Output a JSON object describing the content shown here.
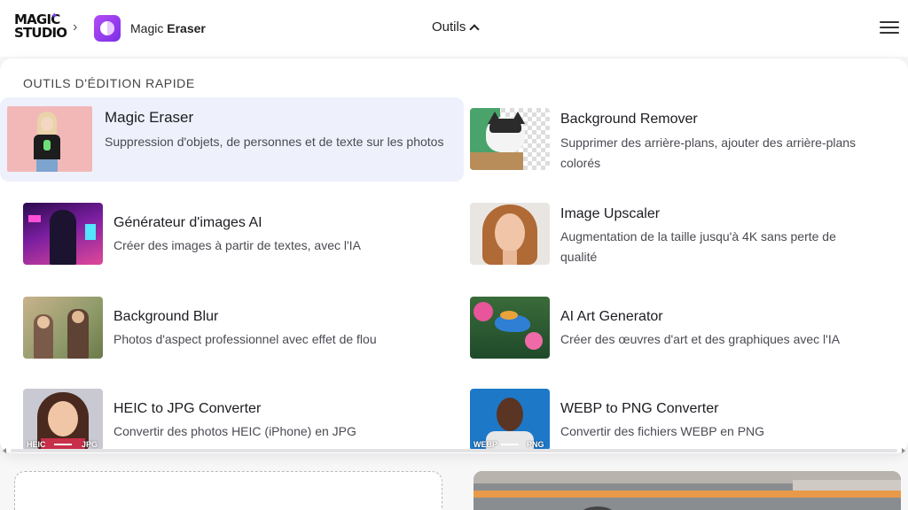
{
  "header": {
    "logo_line1": "MAGIC",
    "logo_line2": "STUDIO",
    "breadcrumb_separator": "›",
    "app_name_prefix": "Magic",
    "app_name_bold": "Eraser",
    "tools_label": "Outils",
    "accent": "#8b3df0"
  },
  "panel": {
    "section_title": "OUTILS D'ÉDITION RAPIDE",
    "tools": [
      {
        "title": "Magic Eraser",
        "desc": "Suppression d'objets, de personnes et de texte sur les photos",
        "active": true
      },
      {
        "title": "Background Remover",
        "desc": "Supprimer des arrière-plans, ajouter des arrière-plans colorés"
      },
      {
        "title": "Générateur d'images AI",
        "desc": "Créer des images à partir de textes, avec l'IA"
      },
      {
        "title": "Image Upscaler",
        "desc": "Augmentation de la taille jusqu'à 4K sans perte de qualité"
      },
      {
        "title": "Background Blur",
        "desc": "Photos d'aspect professionnel avec effet de flou"
      },
      {
        "title": "AI Art Generator",
        "desc": "Créer des œuvres d'art et des graphiques avec l'IA"
      },
      {
        "title": "HEIC to JPG Converter",
        "desc": "Convertir des photos HEIC (iPhone) en JPG",
        "thumb_from": "HEIC",
        "thumb_to": "JPG"
      },
      {
        "title": "WEBP to PNG Converter",
        "desc": "Convertir des fichiers WEBP en PNG",
        "thumb_from": "WEBP",
        "thumb_to": "PNG"
      }
    ]
  },
  "colors": {
    "active_bg": "#eef1fb",
    "panel_bg": "#ffffff",
    "page_bg": "#f7f7f8"
  }
}
